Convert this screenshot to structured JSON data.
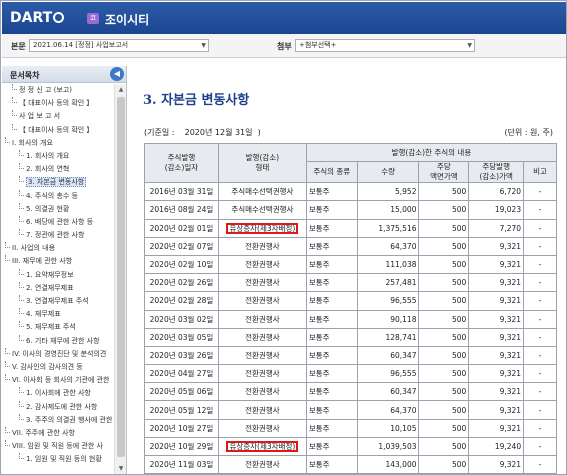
{
  "header": {
    "logo": "DART",
    "corp_badge": "코",
    "corp_name": "조이시티"
  },
  "toolbar": {
    "main_label": "본문",
    "main_select": "2021.06.14 [정정] 사업보고서",
    "attach_label": "첨부",
    "attach_select": "+첨부선택+"
  },
  "sidebar": {
    "title": "문서목차",
    "collapse_icon": "left-arrow",
    "items": [
      {
        "label": "정 정 신 고 (보고)",
        "indent": 1
      },
      {
        "label": "【 대표이사 등의 확인 】",
        "indent": 1
      },
      {
        "label": "사 업 보 고 서",
        "indent": 1
      },
      {
        "label": "【 대표이사 등의 확인 】",
        "indent": 1
      },
      {
        "label": "I. 회사의 개요",
        "indent": 0
      },
      {
        "label": "1. 회사의 개요",
        "indent": 2
      },
      {
        "label": "2. 회사의 연혁",
        "indent": 2
      },
      {
        "label": "3. 자본금 변동사항",
        "indent": 2,
        "selected": true
      },
      {
        "label": "4. 주식의 총수 등",
        "indent": 2
      },
      {
        "label": "5. 의결권 현황",
        "indent": 2
      },
      {
        "label": "6. 배당에 관한 사항 등",
        "indent": 2
      },
      {
        "label": "7. 정관에 관한 사항",
        "indent": 2
      },
      {
        "label": "II. 사업의 내용",
        "indent": 0
      },
      {
        "label": "III. 재무에 관한 사항",
        "indent": 0
      },
      {
        "label": "1. 요약재무정보",
        "indent": 2
      },
      {
        "label": "2. 연결재무제표",
        "indent": 2
      },
      {
        "label": "3. 연결재무제표 주석",
        "indent": 2
      },
      {
        "label": "4. 재무제표",
        "indent": 2
      },
      {
        "label": "5. 재무제표 주석",
        "indent": 2
      },
      {
        "label": "6. 기타 재무에 관한 사항",
        "indent": 2
      },
      {
        "label": "IV. 이사의 경영진단 및 분석의견",
        "indent": 0
      },
      {
        "label": "V. 감사인의 감사의견 등",
        "indent": 0
      },
      {
        "label": "VI. 이사회 등 회사의 기관에 관한",
        "indent": 0
      },
      {
        "label": "1. 이사회에 관한 사항",
        "indent": 2
      },
      {
        "label": "2. 감사제도에 관한 사항",
        "indent": 2
      },
      {
        "label": "3. 주주의 의결권 행사에 관한",
        "indent": 2
      },
      {
        "label": "VII. 주주에 관한 사항",
        "indent": 0
      },
      {
        "label": "VIII. 임원 및 직원 등에 관한 사",
        "indent": 0
      },
      {
        "label": "1. 임원 및 직원 등의 현황",
        "indent": 2
      }
    ]
  },
  "main": {
    "title": "3. 자본금 변동사항",
    "basis_label": "(기준일 :",
    "basis_date": "2020년 12월 31일",
    "basis_close": ")",
    "unit": "(단위 : 원, 주)",
    "headers": {
      "date": "주식발행\n(감소)일자",
      "type": "발행(감소)\n형태",
      "group": "발행(감소)한 주식의 내용",
      "kind": "주식의 종류",
      "qty": "수량",
      "face": "주당\n액면가액",
      "price": "주당발행\n(감소)가액",
      "note": "비고"
    },
    "rows": [
      {
        "date": "2016년 03월 31일",
        "type": "주식매수선택권행사",
        "kind": "보통주",
        "qty": "5,952",
        "face": "500",
        "price": "6,720",
        "note": "-"
      },
      {
        "date": "2016년 08월 24일",
        "type": "주식매수선택권행사",
        "kind": "보통주",
        "qty": "15,000",
        "face": "500",
        "price": "19,023",
        "note": "-"
      },
      {
        "date": "2020년 02월 01일",
        "type": "유상증자(제3자배정)",
        "kind": "보통주",
        "qty": "1,375,516",
        "face": "500",
        "price": "7,270",
        "note": "-",
        "highlight": true
      },
      {
        "date": "2020년 02월 07일",
        "type": "전환권행사",
        "kind": "보통주",
        "qty": "64,370",
        "face": "500",
        "price": "9,321",
        "note": "-"
      },
      {
        "date": "2020년 02월 10일",
        "type": "전환권행사",
        "kind": "보통주",
        "qty": "111,038",
        "face": "500",
        "price": "9,321",
        "note": "-"
      },
      {
        "date": "2020년 02월 26일",
        "type": "전환권행사",
        "kind": "보통주",
        "qty": "257,481",
        "face": "500",
        "price": "9,321",
        "note": "-"
      },
      {
        "date": "2020년 02월 28일",
        "type": "전환권행사",
        "kind": "보통주",
        "qty": "96,555",
        "face": "500",
        "price": "9,321",
        "note": "-"
      },
      {
        "date": "2020년 03월 02일",
        "type": "전환권행사",
        "kind": "보통주",
        "qty": "90,118",
        "face": "500",
        "price": "9,321",
        "note": "-"
      },
      {
        "date": "2020년 03월 05일",
        "type": "전환권행사",
        "kind": "보통주",
        "qty": "128,741",
        "face": "500",
        "price": "9,321",
        "note": "-"
      },
      {
        "date": "2020년 03월 26일",
        "type": "전환권행사",
        "kind": "보통주",
        "qty": "60,347",
        "face": "500",
        "price": "9,321",
        "note": "-"
      },
      {
        "date": "2020년 04월 27일",
        "type": "전환권행사",
        "kind": "보통주",
        "qty": "96,555",
        "face": "500",
        "price": "9,321",
        "note": "-"
      },
      {
        "date": "2020년 05월 06일",
        "type": "전환권행사",
        "kind": "보통주",
        "qty": "60,347",
        "face": "500",
        "price": "9,321",
        "note": "-"
      },
      {
        "date": "2020년 05월 12일",
        "type": "전환권행사",
        "kind": "보통주",
        "qty": "64,370",
        "face": "500",
        "price": "9,321",
        "note": "-"
      },
      {
        "date": "2020년 10월 27일",
        "type": "전환권행사",
        "kind": "보통주",
        "qty": "10,105",
        "face": "500",
        "price": "9,321",
        "note": "-"
      },
      {
        "date": "2020년 10월 29일",
        "type": "유상증자(제3자배정)",
        "kind": "보통주",
        "qty": "1,039,503",
        "face": "500",
        "price": "19,240",
        "note": "-",
        "highlight": true
      },
      {
        "date": "2020년 11월 03일",
        "type": "전환권행사",
        "kind": "보통주",
        "qty": "143,000",
        "face": "500",
        "price": "9,321",
        "note": "-"
      }
    ]
  }
}
